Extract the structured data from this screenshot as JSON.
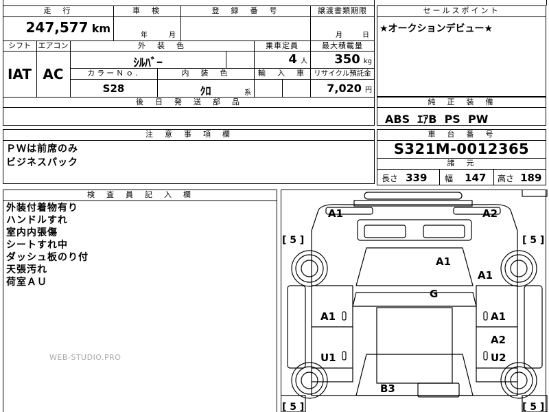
{
  "top_header": {
    "mileage_label": "走　行",
    "inspection_label": "車　検",
    "registration_label": "登　録　番　号",
    "transfer_label": "譲渡書類期限",
    "sales_point_label": "セールスポイント"
  },
  "top_values": {
    "mileage": "247,577",
    "mileage_unit": "km",
    "inspection_year_unit": "年",
    "inspection_month_unit": "月",
    "transfer_month_unit": "月",
    "transfer_day_unit": "日",
    "sales_point": "★オークションデビュー★"
  },
  "mid_header": {
    "shift_label": "シフト",
    "ac_label": "エアコン",
    "exterior_color_label": "外　装　色",
    "capacity_label": "乗車定員",
    "max_load_label": "最大積載量",
    "color_no_label": "カラーＮｏ.",
    "interior_color_label": "内　装　色",
    "import_label": "輸　入　車",
    "recycle_label": "リサイクル預託金"
  },
  "mid_values": {
    "shift": "IAT",
    "ac": "AC",
    "exterior_color": "ｼﾙﾊﾞｰ",
    "capacity": "4",
    "capacity_unit": "人",
    "max_load": "350",
    "max_load_unit": "kg",
    "color_no": "S28",
    "interior_color": "ｸﾛ",
    "interior_color_suffix": "系",
    "recycle_fee": "7,020",
    "recycle_unit": "円"
  },
  "later_parts": {
    "label": "後　日　発　送　部　品"
  },
  "standard_equipment": {
    "label": "純　正　装　備",
    "value": "ABS  ｴｱB  PS  PW"
  },
  "notes": {
    "label": "注　意　事　項　欄",
    "lines": [
      "ＰＷは前席のみ",
      "ビジネスパック"
    ]
  },
  "chassis": {
    "label": "車　台　番　号",
    "value": "S321M-0012365"
  },
  "specs": {
    "label": "諸　元",
    "length_label": "長さ",
    "length": "339",
    "width_label": "幅",
    "width": "147",
    "height_label": "高さ",
    "height": "189"
  },
  "inspector": {
    "label": "検　査　員　記　入　欄",
    "lines": [
      "外装付着物有り",
      "ハンドルすれ",
      "室内内張傷",
      "シートすれ中",
      "ダッシュ板のり付",
      "天張汚れ",
      "荷室ＡＵ"
    ]
  },
  "diagram": {
    "marks": [
      "A1",
      "A2",
      "A1",
      "A1",
      "G",
      "A1",
      "A1",
      "A2",
      "U1",
      "U2",
      "B3"
    ],
    "tire_depths": [
      "[ 5 ]",
      "[ 5 ]",
      "[ 5 ]",
      "[ 5 ]"
    ]
  },
  "watermark": "WEB-STUDIO.PRO"
}
